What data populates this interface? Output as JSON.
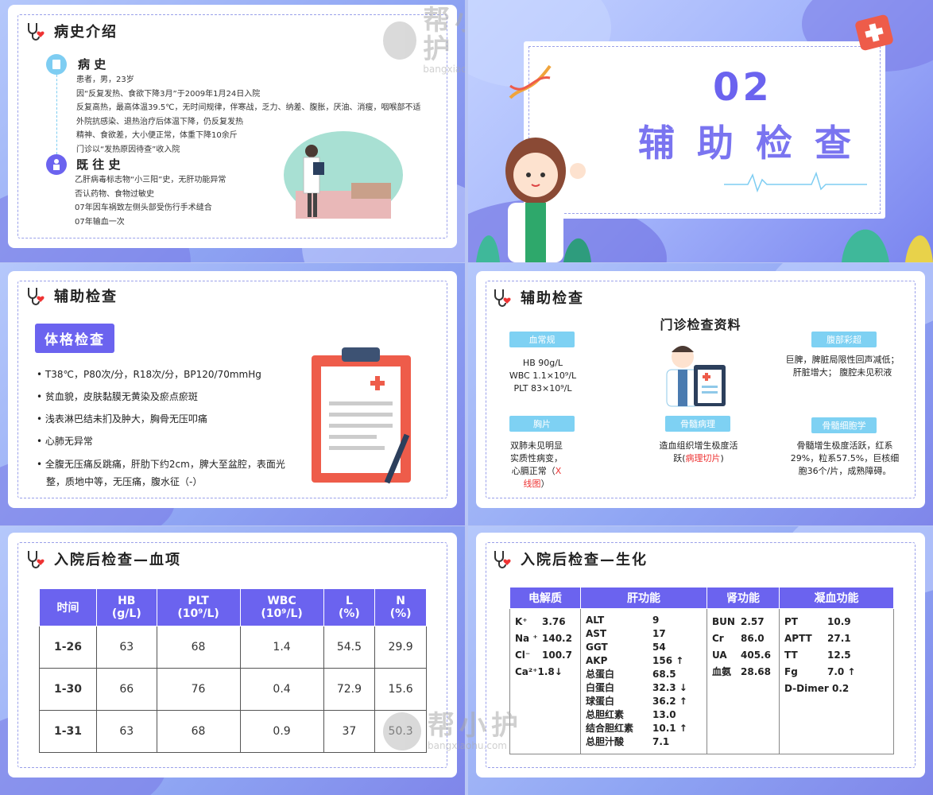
{
  "watermark": {
    "title": "帮小护",
    "site": "bangxiaohu.com"
  },
  "slide1": {
    "title": "病史介绍",
    "history_heading": "病 史",
    "history_lines": [
      "患者，男，23岁",
      "因“反复发热、食欲下降3月”于2009年1月24日入院",
      "反复高热，最高体温39.5℃，无时间规律，伴寒战，乏力、纳差、腹胀，厌油、消瘦，咽喉部不适",
      "外院抗感染、退热治疗后体温下降，仍反复发热",
      "精神、食欲差，大小便正常，体重下降10余斤",
      "门诊以“发热原因待查”收入院"
    ],
    "past_heading": "既 往 史",
    "past_lines": [
      "乙肝病毒标志物“小三阳”史，无肝功能异常",
      "否认药物、食物过敏史",
      "07年因车祸致左侧头部受伤行手术缝合",
      "07年输血一次"
    ]
  },
  "slide2": {
    "number": "02",
    "title": "辅 助 检 查"
  },
  "slide3": {
    "title": "辅助检查",
    "badge": "体格检查",
    "items": [
      "T38℃，P80次/分，R18次/分，BP120/70mmHg",
      "贫血貌，皮肤黏膜无黄染及瘀点瘀斑",
      "浅表淋巴结未扪及肿大，胸骨无压叩痛",
      "心肺无异常",
      "全腹无压痛反跳痛，肝肋下约2cm，脾大至盆腔，表面光整，质地中等，无压痛，腹水征（-）"
    ]
  },
  "slide4": {
    "title": "辅助检查",
    "center_title": "门诊检查资料",
    "blood": {
      "label": "血常规",
      "lines": [
        "HB 90g/L",
        "WBC 1.1×10⁹/L",
        "PLT 83×10⁹/L"
      ]
    },
    "abdomen": {
      "label": "腹部彩超",
      "text": "巨脾，脾脏局限性回声减低；肝脏增大；  腹腔未见积液"
    },
    "chest": {
      "label": "胸片",
      "text_a": "双肺未见明显实质性病变，心膈正常（",
      "text_b": "X线图",
      "text_c": "）"
    },
    "marrow_path": {
      "label": "骨髓病理",
      "text_a": "造血组织增生极度活跃(",
      "text_b": "病理切片",
      "text_c": ")"
    },
    "marrow_cell": {
      "label": "骨髓细胞学",
      "text": "骨髓增生极度活跃，红系29%，粒系57.5%，巨核细胞36个/片，成熟障碍。"
    }
  },
  "slide5": {
    "title": "入院后检查—血项",
    "headers": [
      [
        "时间",
        ""
      ],
      [
        "HB",
        "(g/L)"
      ],
      [
        "PLT",
        "(10⁹/L)"
      ],
      [
        "WBC",
        "(10⁹/L)"
      ],
      [
        "L",
        "(%)"
      ],
      [
        "N",
        "(%)"
      ]
    ],
    "rows": [
      [
        "1-26",
        "63",
        "68",
        "1.4",
        "54.5",
        "29.9"
      ],
      [
        "1-30",
        "66",
        "76",
        "0.4",
        "72.9",
        "15.6"
      ],
      [
        "1-31",
        "63",
        "68",
        "0.9",
        "37",
        "50.3"
      ]
    ]
  },
  "slide6": {
    "title": "入院后检查—生化",
    "headers": [
      "电解质",
      "肝功能",
      "肾功能",
      "凝血功能"
    ],
    "electrolytes": [
      [
        "K⁺",
        "3.76"
      ],
      [
        "Na ⁺",
        "140.2"
      ],
      [
        "Cl⁻",
        "100.7"
      ],
      [
        "Ca²⁺",
        "1.8↓"
      ]
    ],
    "liver": [
      [
        "ALT",
        "9"
      ],
      [
        "AST",
        "17"
      ],
      [
        "GGT",
        "54"
      ],
      [
        "AKP",
        "156 ↑"
      ],
      [
        "总蛋白",
        "68.5"
      ],
      [
        "白蛋白",
        "32.3 ↓"
      ],
      [
        "球蛋白",
        "36.2 ↑"
      ],
      [
        "总胆红素",
        "13.0"
      ],
      [
        "结合胆红素",
        "10.1 ↑"
      ],
      [
        "总胆汁酸",
        "7.1"
      ]
    ],
    "kidney": [
      [
        "BUN",
        "2.57"
      ],
      [
        "Cr",
        "86.0"
      ],
      [
        "UA",
        "405.6"
      ],
      [
        "血氨",
        "28.68"
      ]
    ],
    "coag": [
      [
        "PT",
        "10.9"
      ],
      [
        "APTT",
        "27.1"
      ],
      [
        "TT",
        "12.5"
      ],
      [
        "Fg",
        "7.0 ↑"
      ],
      [
        "D-Dimer",
        "0.2"
      ]
    ]
  }
}
